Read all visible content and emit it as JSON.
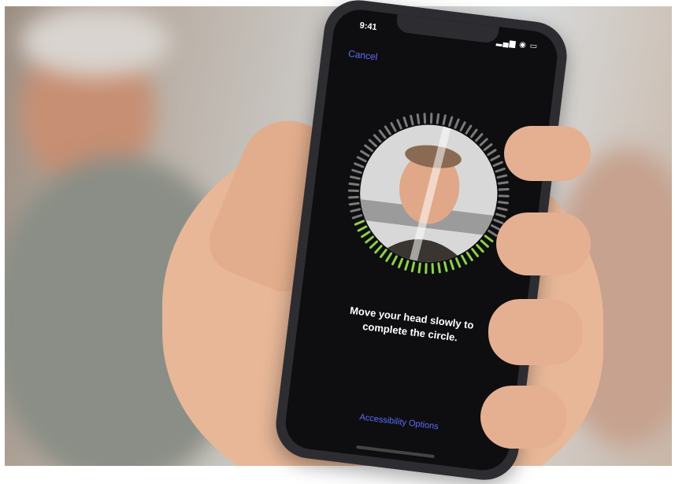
{
  "status_bar": {
    "time": "9:41",
    "icons": "▂▄▆ ◉ ▭"
  },
  "enrollment": {
    "cancel_label": "Cancel",
    "instructions_line1": "Move your head slowly to",
    "instructions_line2": "complete the circle.",
    "accessibility_label": "Accessibility Options",
    "progress_fraction": 0.34
  },
  "colors": {
    "accent_link": "#5f6bff",
    "progress_tick": "#8bd14b",
    "pending_tick": "#7a7a7a",
    "screen_background": "#0e0e10"
  }
}
